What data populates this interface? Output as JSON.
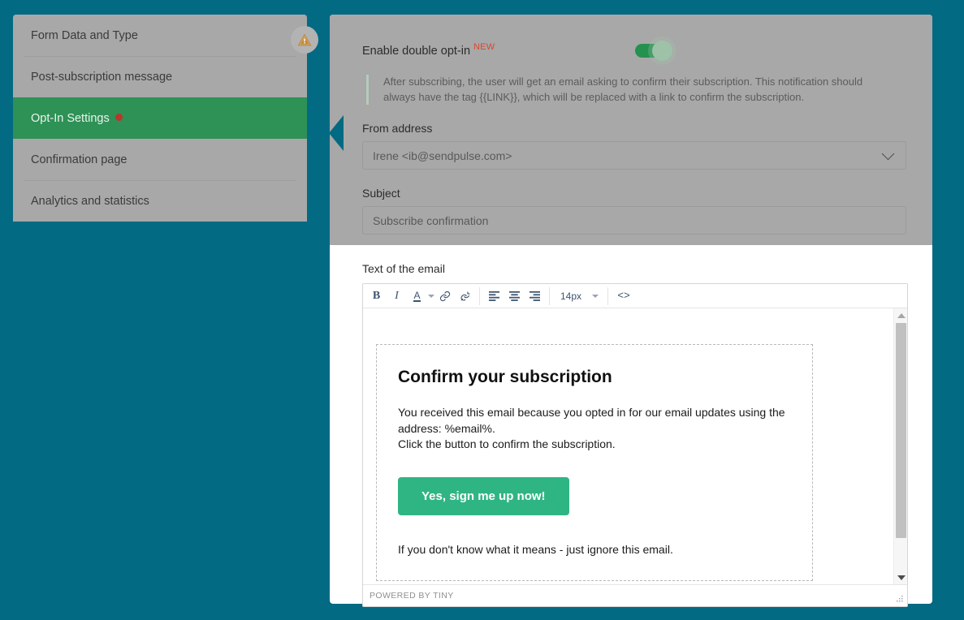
{
  "theme": {
    "background": "#026a83",
    "sidebar_bg": "#a8a8a8",
    "active_item_bg": "#2e9156",
    "panel_bg": "#ffffff",
    "overlay_bg": "#a8a8a8",
    "accent_green": "#24914f",
    "cta_green": "#2fb584",
    "badge_red": "#d9472e",
    "dot_red": "#b8372a",
    "warning_orange": "#c9862a"
  },
  "sidebar": {
    "items": [
      {
        "label": "Form Data and Type",
        "active": false,
        "has_warning": true
      },
      {
        "label": "Post-subscription message",
        "active": false
      },
      {
        "label": "Opt-In Settings",
        "active": true,
        "has_dot": true
      },
      {
        "label": "Confirmation page",
        "active": false
      },
      {
        "label": "Analytics and statistics",
        "active": false
      }
    ],
    "warning_icon": "warning-triangle-icon"
  },
  "panel": {
    "toggle": {
      "label": "Enable double opt-in",
      "badge": "NEW",
      "state": "on"
    },
    "info_note": "After subscribing, the user will get an email asking to confirm their subscription. This notification should always have the tag {{LINK}}, which will be replaced with a link to confirm the subscription.",
    "from_address": {
      "label": "From address",
      "value": "Irene <ib@sendpulse.com>",
      "icon": "chevron-down-icon"
    },
    "subject": {
      "label": "Subject",
      "value": "Subscribe confirmation",
      "placeholder": "Subscribe confirmation"
    },
    "editor": {
      "label": "Text of the email",
      "toolbar": {
        "bold": "B",
        "italic": "I",
        "text_color": "A",
        "text_color_caret": "chevron-down-icon",
        "link": "link-icon",
        "unlink": "unlink-icon",
        "align_left": "align-left-icon",
        "align_center": "align-center-icon",
        "align_right": "align-right-icon",
        "font_size": "14px",
        "font_size_caret": "chevron-down-icon",
        "source_code": "<>"
      },
      "content": {
        "title": "Confirm your subscription",
        "paragraph_line1": "You received this email because you opted in for our email updates using the",
        "paragraph_line2": "address: %email%.",
        "paragraph_line3": "Click the button to confirm the subscription.",
        "cta_label": "Yes, sign me up now!",
        "footer": "If you don't know what it means - just ignore this email."
      },
      "status_bar": "POWERED BY TINY",
      "scrollbar": {
        "up_icon": "scroll-up-arrow-icon",
        "down_icon": "scroll-down-arrow-icon"
      },
      "resize_grip": "resize-grip-icon"
    }
  }
}
